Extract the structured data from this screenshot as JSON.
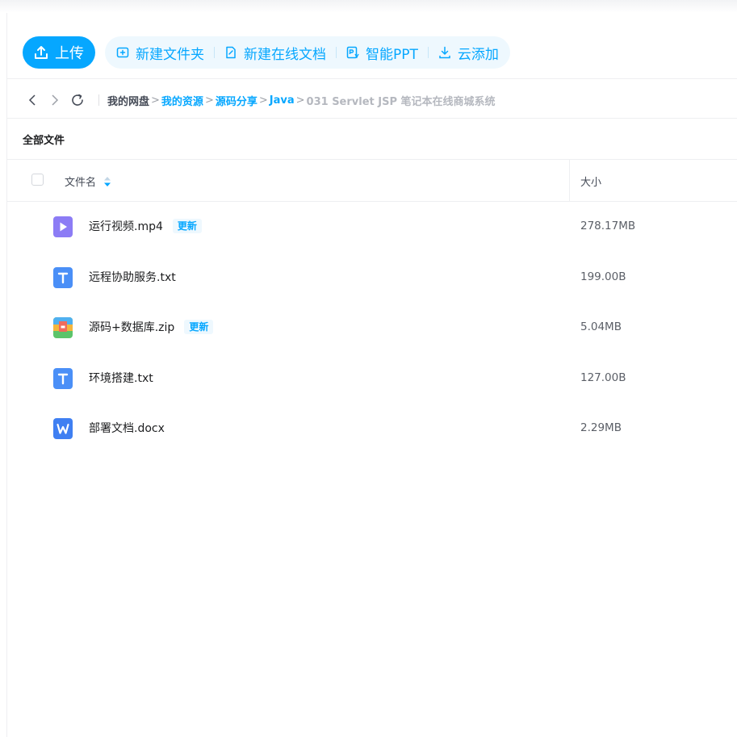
{
  "toolbar": {
    "upload_label": "上传",
    "new_folder_label": "新建文件夹",
    "new_doc_label": "新建在线文档",
    "smart_ppt_label": "智能PPT",
    "cloud_add_label": "云添加"
  },
  "breadcrumb": {
    "root": "我的网盘",
    "items": [
      "我的资源",
      "源码分享",
      "Java"
    ],
    "current": "031 Servlet JSP 笔记本在线商城系统",
    "separator": ">"
  },
  "section_title": "全部文件",
  "table": {
    "columns": {
      "name": "文件名",
      "size": "大小"
    },
    "rows": [
      {
        "name": "运行视频.mp4",
        "size": "278.17MB",
        "badge": "更新",
        "icon": "video-file-icon"
      },
      {
        "name": "远程协助服务.txt",
        "size": "199.00B",
        "badge": "",
        "icon": "text-file-icon"
      },
      {
        "name": "源码+数据库.zip",
        "size": "5.04MB",
        "badge": "更新",
        "icon": "zip-file-icon"
      },
      {
        "name": "环境搭建.txt",
        "size": "127.00B",
        "badge": "",
        "icon": "text-file-icon"
      },
      {
        "name": "部署文档.docx",
        "size": "2.29MB",
        "badge": "",
        "icon": "word-file-icon"
      }
    ]
  },
  "colors": {
    "accent": "#06a7ff",
    "accent_light": "#eef8fe",
    "video_icon": "#8c7cf5",
    "text_icon": "#4a8ff7",
    "word_icon": "#3f7ff2"
  }
}
